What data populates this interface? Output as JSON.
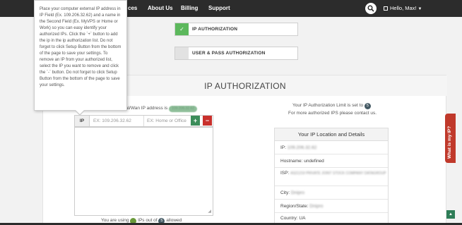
{
  "nav": {
    "items": [
      "ces",
      "About Us",
      "Billing",
      "Support"
    ],
    "user_label": "Hello, Max!"
  },
  "options": {
    "ip_auth": "IP AUTHORIZATION",
    "user_pass_auth": "USER & PASS AUTHORIZATION"
  },
  "panel": {
    "title": "IP AUTHORIZATION",
    "external_ip_text": "al/Wan IP address is",
    "external_ip_value": "109.206.32.62",
    "limit_text": "Your IP Authorization Limit is set to",
    "limit_value": "5",
    "contact_text": "For more authorized IPS please contact us."
  },
  "form": {
    "ip_label": "IP",
    "ip_placeholder": "EX: 109.206.32.62",
    "name_placeholder": "EX: Home or Office",
    "add_label": "+",
    "remove_label": "−"
  },
  "usage": {
    "prefix": "You are using",
    "used": "1",
    "middle": "IPs out of",
    "total": "5",
    "suffix": "allowed"
  },
  "details": {
    "heading": "Your IP Location and Details",
    "ip_label": "IP:",
    "ip_value": "109.206.32.62",
    "hostname": "Hostname: undefined",
    "isp_label": "ISP:",
    "isp_value": "AS21219 PRIVATE JOINT STOCK COMPANY DATAGROUP",
    "city_label": "City:",
    "city_value": "Dnipro",
    "region_label": "Region/State:",
    "region_value": "Dnipro",
    "country": "Country: UA"
  },
  "tooltip": {
    "text": "Place your computer external IP address in IP Field (Ex. 109.206.32.62) and a name in the Second Field (Ex. MyVPS or Home or Work) so you can easy identify your authorized IPs. Click the `+` button to add the ip in the ip authorization list. Do not forget to click Setup Button from the bottom of the page to save your settings. To remove an IP from your authorized list, select the IP you want to remove and click the `-` button. Do not forget to click Setup Button from the bottom of the page to save your settings."
  },
  "side_tab": {
    "label": "What is my IP?"
  },
  "colors": {
    "topbar": "#2c2c2c",
    "accent_green": "#5cb85c",
    "accent_red": "#c0392b"
  }
}
